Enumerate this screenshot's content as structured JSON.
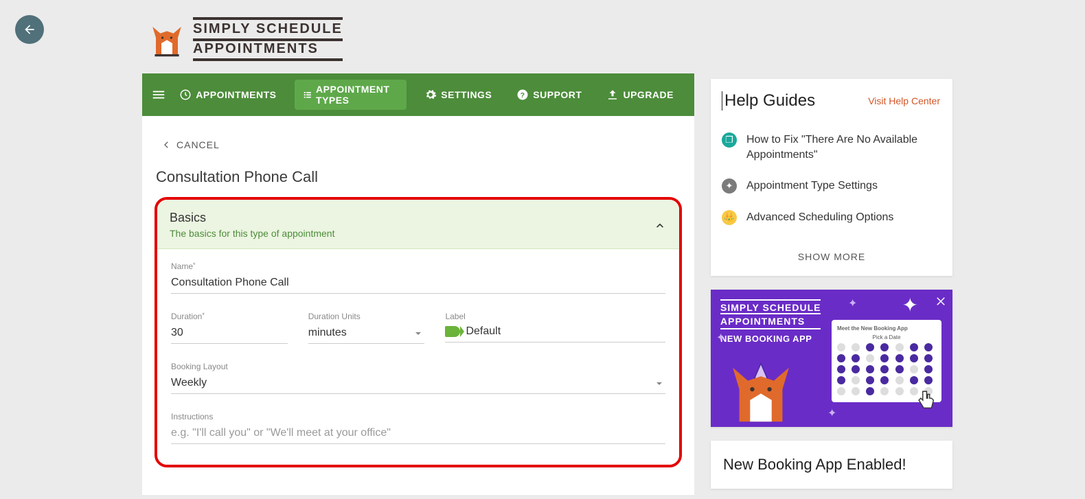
{
  "app": {
    "logo_line1": "SIMPLY SCHEDULE",
    "logo_line2": "APPOINTMENTS"
  },
  "nav": {
    "appointments": "APPOINTMENTS",
    "appointment_types": "APPOINTMENT TYPES",
    "settings": "SETTINGS",
    "support": "SUPPORT",
    "upgrade": "UPGRADE"
  },
  "page": {
    "cancel": "CANCEL",
    "title": "Consultation Phone Call"
  },
  "basics": {
    "header_title": "Basics",
    "header_sub": "The basics for this type of appointment",
    "name_label": "Name",
    "name_value": "Consultation Phone Call",
    "duration_label": "Duration",
    "duration_value": "30",
    "duration_units_label": "Duration Units",
    "duration_units_value": "minutes",
    "color_label": "Label",
    "color_value": "Default",
    "layout_label": "Booking Layout",
    "layout_value": "Weekly",
    "instructions_label": "Instructions",
    "instructions_placeholder": "e.g. \"I'll call you\" or \"We'll meet at your office\""
  },
  "help": {
    "title": "Help Guides",
    "visit": "Visit Help Center",
    "items": [
      "How to Fix \"There Are No Available Appointments\"",
      "Appointment Type Settings",
      "Advanced Scheduling Options"
    ],
    "show_more": "SHOW MORE"
  },
  "promo": {
    "line1": "SIMPLY SCHEDULE",
    "line2": "APPOINTMENTS",
    "line3": "NEW BOOKING APP",
    "meet": "Meet the New Booking App",
    "pick": "Pick a Date"
  },
  "enabled": {
    "title": "New Booking App Enabled!"
  }
}
